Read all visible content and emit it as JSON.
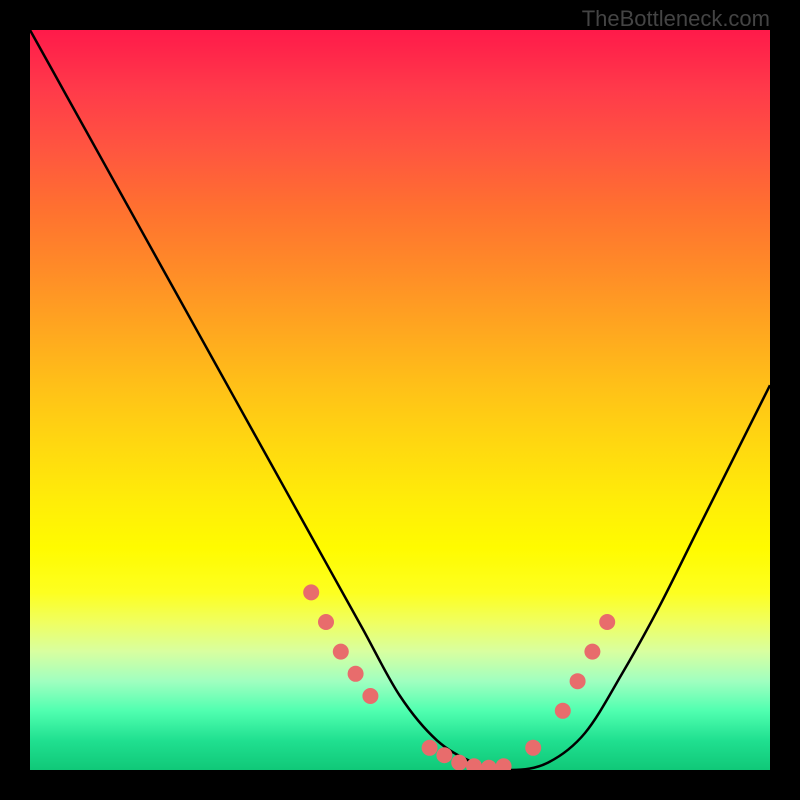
{
  "watermark": "TheBottleneck.com",
  "chart_data": {
    "type": "line",
    "title": "",
    "xlabel": "",
    "ylabel": "",
    "xlim": [
      0,
      100
    ],
    "ylim": [
      0,
      100
    ],
    "series": [
      {
        "name": "bottleneck-curve",
        "x": [
          0,
          5,
          10,
          15,
          20,
          25,
          30,
          35,
          40,
          45,
          50,
          55,
          60,
          65,
          70,
          75,
          80,
          85,
          90,
          95,
          100
        ],
        "y": [
          100,
          91,
          82,
          73,
          64,
          55,
          46,
          37,
          28,
          19,
          10,
          4,
          1,
          0,
          1,
          5,
          13,
          22,
          32,
          42,
          52
        ]
      }
    ],
    "markers": {
      "name": "highlighted-points",
      "color": "#e86c6c",
      "x": [
        38,
        40,
        42,
        44,
        46,
        54,
        56,
        58,
        60,
        62,
        64,
        68,
        72,
        74,
        76,
        78
      ],
      "y": [
        24,
        20,
        16,
        13,
        10,
        3,
        2,
        1,
        0.5,
        0.3,
        0.5,
        3,
        8,
        12,
        16,
        20
      ]
    }
  },
  "colors": {
    "curve": "#000000",
    "marker": "#e86c6c",
    "background_top": "#ff1a4a",
    "background_bottom": "#10c878"
  }
}
